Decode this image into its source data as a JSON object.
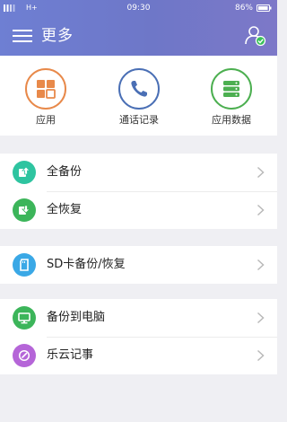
{
  "status_bar": {
    "network": "H+",
    "time": "09:30",
    "battery": "86%"
  },
  "app_bar": {
    "title": "更多"
  },
  "quick_actions": [
    {
      "label": "应用",
      "icon": "apps-grid-icon",
      "color": "#e8894a"
    },
    {
      "label": "通话记录",
      "icon": "phone-icon",
      "color": "#4a6fb5"
    },
    {
      "label": "应用数据",
      "icon": "database-icon",
      "color": "#4caf50"
    }
  ],
  "groups": [
    {
      "items": [
        {
          "label": "全备份",
          "icon": "full-backup-icon",
          "color": "#2ec4a0"
        },
        {
          "label": "全恢复",
          "icon": "full-restore-icon",
          "color": "#3cb55a"
        }
      ]
    },
    {
      "items": [
        {
          "label": "SD卡备份/恢复",
          "icon": "sd-card-icon",
          "color": "#3aa8e6"
        }
      ]
    },
    {
      "items": [
        {
          "label": "备份到电脑",
          "icon": "computer-icon",
          "color": "#3cb55a"
        },
        {
          "label": "乐云记事",
          "icon": "notes-icon",
          "color": "#b565d8"
        }
      ]
    }
  ],
  "colors": {
    "header_gradient_start": "#6e7fd3",
    "header_gradient_end": "#7d78c8",
    "background": "#efeff3",
    "badge_green": "#39c15a"
  }
}
